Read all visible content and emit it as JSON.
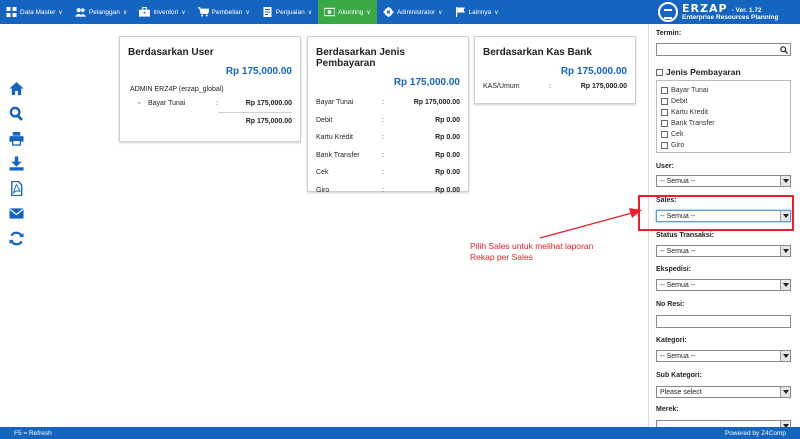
{
  "nav": {
    "items": [
      {
        "label": "Data Master",
        "icon": "grid-icon"
      },
      {
        "label": "Pelanggan",
        "icon": "users-icon"
      },
      {
        "label": "Inventori",
        "icon": "briefcase-icon"
      },
      {
        "label": "Pembelian",
        "icon": "cart-icon"
      },
      {
        "label": "Penjualan",
        "icon": "document-icon"
      },
      {
        "label": "Akunting",
        "icon": "money-icon",
        "active": true
      },
      {
        "label": "Administrator",
        "icon": "gear-icon"
      },
      {
        "label": "Lainnya",
        "icon": "flag-icon"
      }
    ],
    "brand_name": "ERZAP",
    "version": "- Ver. 1.72",
    "brand_sub": "Enterprise Resources Planning",
    "color": "#1565c0",
    "active_color": "#3aa845"
  },
  "toolbar": [
    "home-icon",
    "search-icon",
    "print-icon",
    "download-icon",
    "pdf-icon",
    "email-icon",
    "refresh-icon"
  ],
  "cards": {
    "user": {
      "title": "Berdasarkan User",
      "total": "Rp 175,000.00",
      "user_name": "ADMIN ERZ4P (erzap_global)",
      "rows": [
        {
          "label": "Bayar Tunai",
          "value": "Rp 175,000.00"
        }
      ],
      "subtotal": "Rp 175,000.00"
    },
    "jenis": {
      "title": "Berdasarkan Jenis Pembayaran",
      "total": "Rp 175,000.00",
      "rows": [
        {
          "label": "Bayar Tunai",
          "value": "Rp 175,000.00"
        },
        {
          "label": "Debit",
          "value": "Rp 0.00"
        },
        {
          "label": "Kartu Kredit",
          "value": "Rp 0.00"
        },
        {
          "label": "Bank Transfer",
          "value": "Rp 0.00"
        },
        {
          "label": "Cek",
          "value": "Rp 0.00"
        },
        {
          "label": "Giro",
          "value": "Rp 0.00"
        }
      ]
    },
    "kas": {
      "title": "Berdasarkan Kas Bank",
      "total": "Rp 175,000.00",
      "rows": [
        {
          "label": "KAS/Umum",
          "value": "Rp 175,000.00"
        }
      ]
    },
    "separator": ":"
  },
  "annotation": {
    "line1": "Pilih Sales untuk melihat laporan",
    "line2": "Rekap per Sales",
    "color": "#e8202a"
  },
  "filters": {
    "termin_label": "Termin:",
    "jenis_label": "Jenis Pembayaran",
    "jenis_items": [
      "Bayar Tunai",
      "Debit",
      "Kartu Kredit",
      "Bank Transfer",
      "Cek",
      "Giro"
    ],
    "user_label": "User:",
    "user_value": "-- Semua --",
    "sales_label": "Sales:",
    "sales_value": "-- Semua --",
    "status_label": "Status Transaksi:",
    "status_value": "-- Semua --",
    "ekspedisi_label": "Ekspedisi:",
    "ekspedisi_value": "-- Semua --",
    "noresi_label": "No Resi:",
    "kategori_label": "Kategori:",
    "kategori_value": "-- Semua --",
    "subkategori_label": "Sub Kategori:",
    "subkategori_value": "Please select",
    "merek_label": "Merek:"
  },
  "footer": {
    "left": "F5 = Refresh",
    "right": "Powered by Z4Comp"
  }
}
